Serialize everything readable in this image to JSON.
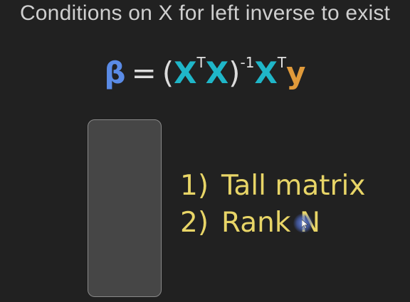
{
  "title": "Conditions on X for left inverse to exist",
  "equation": {
    "beta": "β",
    "equals": "=",
    "open_paren": "(",
    "x1": "X",
    "t1": "T",
    "x2": "X",
    "close_paren": ")",
    "inv": "-1",
    "x3": "X",
    "t2": "T",
    "y": "y"
  },
  "conditions": [
    {
      "number": "1)",
      "text": "Tall matrix"
    },
    {
      "number": "2)",
      "text": "Rank N"
    }
  ],
  "colors": {
    "background": "#212121",
    "title": "#cfcfcf",
    "beta": "#5a8be6",
    "x": "#1fb6c8",
    "y": "#e09a3a",
    "conditions": "#e8d567",
    "matrix_fill": "#464646",
    "matrix_border": "#8a8a8a"
  }
}
